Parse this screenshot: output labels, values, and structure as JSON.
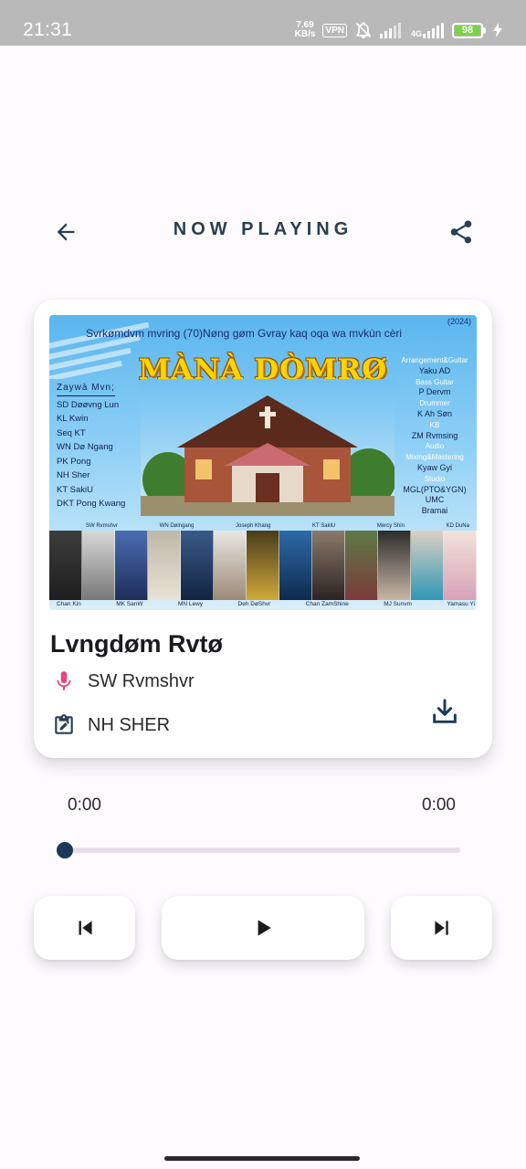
{
  "status_bar": {
    "time": "21:31",
    "net_speed_value": "7.69",
    "net_speed_unit": "KB/s",
    "vpn": "VPN",
    "network_type": "4G",
    "battery": "98"
  },
  "header": {
    "title": "NOW PLAYING"
  },
  "cover": {
    "header_text": "Svrkømdvm mvring (70)Nøng gøm Gvray kaq oqa wa mvkùn cèri",
    "year": "(2024)",
    "title": "MÀNÀ DÒMRØ",
    "left_heading": "Zaywà Mvn;",
    "left_names": [
      "SD Døøvng Lun",
      "KL Kwin",
      "Seq KT",
      "WN Dø Ngang",
      "PK Pong",
      "NH Sher",
      "KT SakiU",
      "DKT Pong Kwang"
    ],
    "right_lines": [
      {
        "text": "Arrangement&Guitar",
        "light": true
      },
      {
        "text": "Yaku AD",
        "light": false
      },
      {
        "text": "Bass Guitar",
        "light": true
      },
      {
        "text": "P Dervm",
        "light": false
      },
      {
        "text": "Drummer",
        "light": true
      },
      {
        "text": "K Ah Søn",
        "light": false
      },
      {
        "text": "KB",
        "light": true
      },
      {
        "text": "ZM Rvmsing",
        "light": false
      },
      {
        "text": "Audio Mixing&Mastering",
        "light": true
      },
      {
        "text": "Kyaw Gyi",
        "light": false
      },
      {
        "text": "Studio",
        "light": true
      },
      {
        "text": "MGL(PTO&YGN)",
        "light": false
      },
      {
        "text": "UMC",
        "light": false
      },
      {
        "text": "Bramai",
        "light": false
      }
    ],
    "top_names": [
      "SW Rvmshvr",
      "WN Dølngang",
      "Joseph Khang",
      "KT SakiU",
      "Mercy Shin",
      "KD DuNa"
    ],
    "bottom_names": [
      "Chan Kin",
      "MK SanW",
      "MN Lewy",
      "Deh DøShvr",
      "Chan ZamShine",
      "MJ Sunvm",
      "Yamasu Yi"
    ]
  },
  "track": {
    "title": "Lvngdøm Rvtø",
    "singer": "SW Rvmshvr",
    "composer": "NH SHER"
  },
  "progress": {
    "current": "0:00",
    "total": "0:00",
    "fraction": 0.0
  },
  "icons": {
    "back": "arrow-left-icon",
    "share": "share-icon",
    "singer": "microphone-icon",
    "composer": "edit-note-icon",
    "download": "download-icon",
    "previous": "skip-previous-icon",
    "play": "play-icon",
    "next": "skip-next-icon"
  },
  "colors": {
    "accent": "#1c3a57",
    "mic": "#e8467c",
    "title": "#2c3e50"
  }
}
